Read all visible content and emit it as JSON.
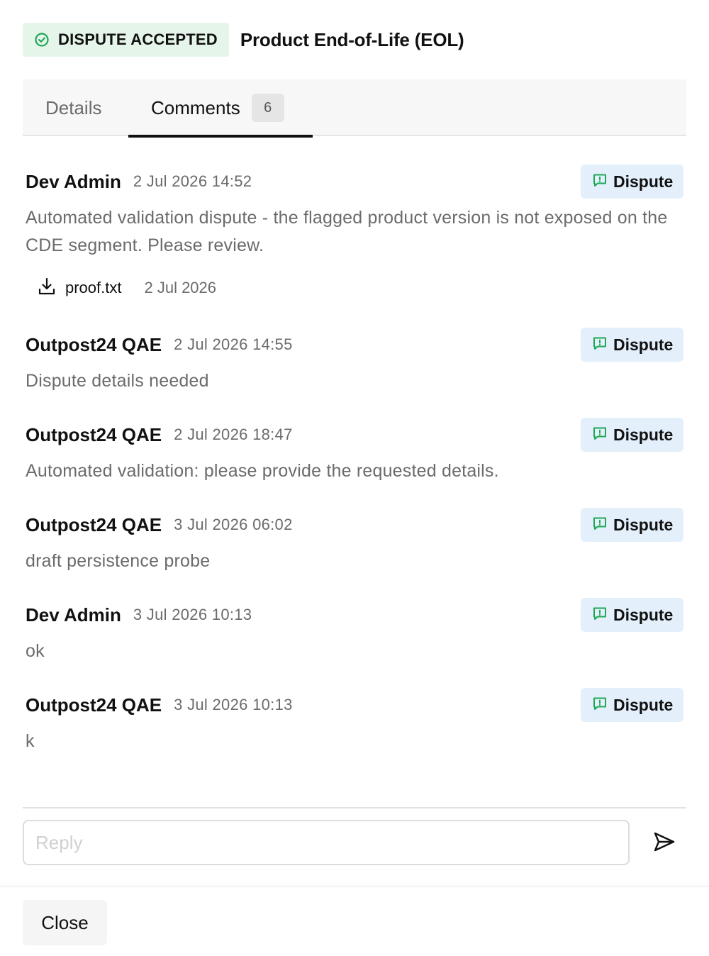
{
  "header": {
    "status_label": "DISPUTE ACCEPTED",
    "status_icon": "check-circle-icon",
    "status_color": "#1fa855",
    "title": "Product End-of-Life (EOL)"
  },
  "tabs": [
    {
      "label": "Details",
      "active": false
    },
    {
      "label": "Comments",
      "active": true,
      "count": "6"
    }
  ],
  "comments": [
    {
      "author": "Dev Admin",
      "timestamp": "2 Jul 2026 14:52",
      "tag": "Dispute",
      "text": "Automated validation dispute - the flagged product version is not exposed on the CDE segment. Please review.",
      "attachment": {
        "name": "proof.txt",
        "date": "2 Jul 2026"
      }
    },
    {
      "author": "Outpost24 QAE",
      "timestamp": "2 Jul 2026 14:55",
      "tag": "Dispute",
      "text": "Dispute details needed"
    },
    {
      "author": "Outpost24 QAE",
      "timestamp": "2 Jul 2026 18:47",
      "tag": "Dispute",
      "text": "Automated validation: please provide the requested details."
    },
    {
      "author": "Outpost24 QAE",
      "timestamp": "3 Jul 2026 06:02",
      "tag": "Dispute",
      "text": "draft persistence probe"
    },
    {
      "author": "Dev Admin",
      "timestamp": "3 Jul 2026 10:13",
      "tag": "Dispute",
      "text": "ok"
    },
    {
      "author": "Outpost24 QAE",
      "timestamp": "3 Jul 2026 10:13",
      "tag": "Dispute",
      "text": "k"
    }
  ],
  "reply": {
    "placeholder": "Reply",
    "value": ""
  },
  "footer": {
    "close_label": "Close"
  },
  "colors": {
    "accent_green": "#1fa855",
    "tag_background": "#e3effb",
    "status_background": "#e6f5ea"
  }
}
